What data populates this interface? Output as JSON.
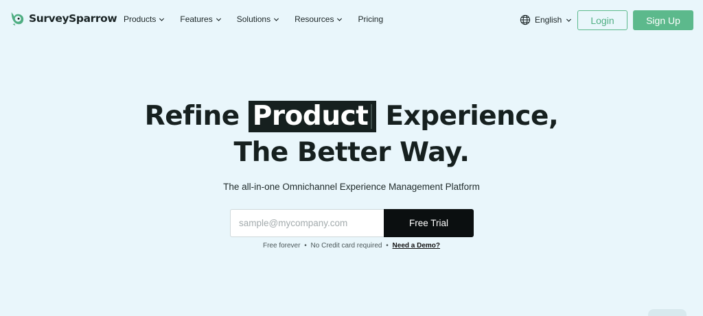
{
  "brand": {
    "name": "SurveySparrow",
    "logo_icon": "sparrow-logo-icon",
    "accent_color": "#5cb98c"
  },
  "nav": {
    "items": [
      {
        "label": "Products",
        "has_dropdown": true
      },
      {
        "label": "Features",
        "has_dropdown": true
      },
      {
        "label": "Solutions",
        "has_dropdown": true
      },
      {
        "label": "Resources",
        "has_dropdown": true
      },
      {
        "label": "Pricing",
        "has_dropdown": false
      }
    ]
  },
  "language": {
    "icon": "globe-icon",
    "selected": "English"
  },
  "auth": {
    "login_label": "Login",
    "signup_label": "Sign Up"
  },
  "hero": {
    "title_before": "Refine",
    "title_highlight": "Product",
    "title_after": "Experience,",
    "title_line2": "The Better Way.",
    "subtitle": "The all-in-one Omnichannel Experience Management Platform"
  },
  "form": {
    "email_placeholder": "sample@mycompany.com",
    "email_value": "",
    "submit_label": "Free Trial"
  },
  "note": {
    "part1": "Free forever",
    "part2": "No Credit card required",
    "separator": "•",
    "demo_link": "Need a Demo?"
  },
  "colors": {
    "background": "#e9f6fb",
    "heading": "#16201f",
    "cta_dark": "#0b0f10"
  }
}
